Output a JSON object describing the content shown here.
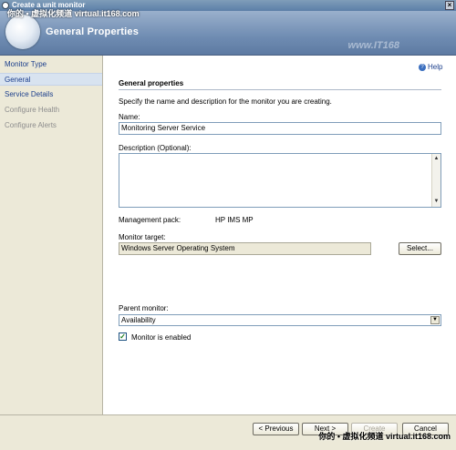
{
  "window": {
    "title": "Create a unit monitor",
    "close_glyph": "×",
    "watermark_top": "你的 • 虚拟化频道  virtual.it168.com",
    "watermark_bottom": "你的 • 虚拟化频道  virtual.it168.com",
    "watermark_faint": "www.IT168"
  },
  "banner": {
    "title": "General Properties"
  },
  "nav": {
    "items": [
      {
        "label": "Monitor Type",
        "state": "normal"
      },
      {
        "label": "General",
        "state": "selected"
      },
      {
        "label": "Service Details",
        "state": "normal"
      },
      {
        "label": "Configure Health",
        "state": "disabled"
      },
      {
        "label": "Configure Alerts",
        "state": "disabled"
      }
    ]
  },
  "help": {
    "label": "Help",
    "icon": "help-icon"
  },
  "form": {
    "section_title": "General properties",
    "intro": "Specify the name and description for the monitor you are creating.",
    "name_label": "Name:",
    "name_value": "Monitoring Server Service",
    "description_label": "Description (Optional):",
    "description_value": "",
    "management_pack_label": "Management pack:",
    "management_pack_value": "HP IMS MP",
    "monitor_target_label": "Monitor target:",
    "monitor_target_value": "Windows Server Operating System",
    "select_button": "Select...",
    "parent_monitor_label": "Parent monitor:",
    "parent_monitor_value": "Availability",
    "enabled_label": "Monitor is enabled",
    "enabled_checked": true
  },
  "footer": {
    "previous": "< Previous",
    "next": "Next >",
    "create": "Create",
    "cancel": "Cancel"
  },
  "colors": {
    "nav_link": "#1c3f8c",
    "banner": "#6f8cb2"
  }
}
